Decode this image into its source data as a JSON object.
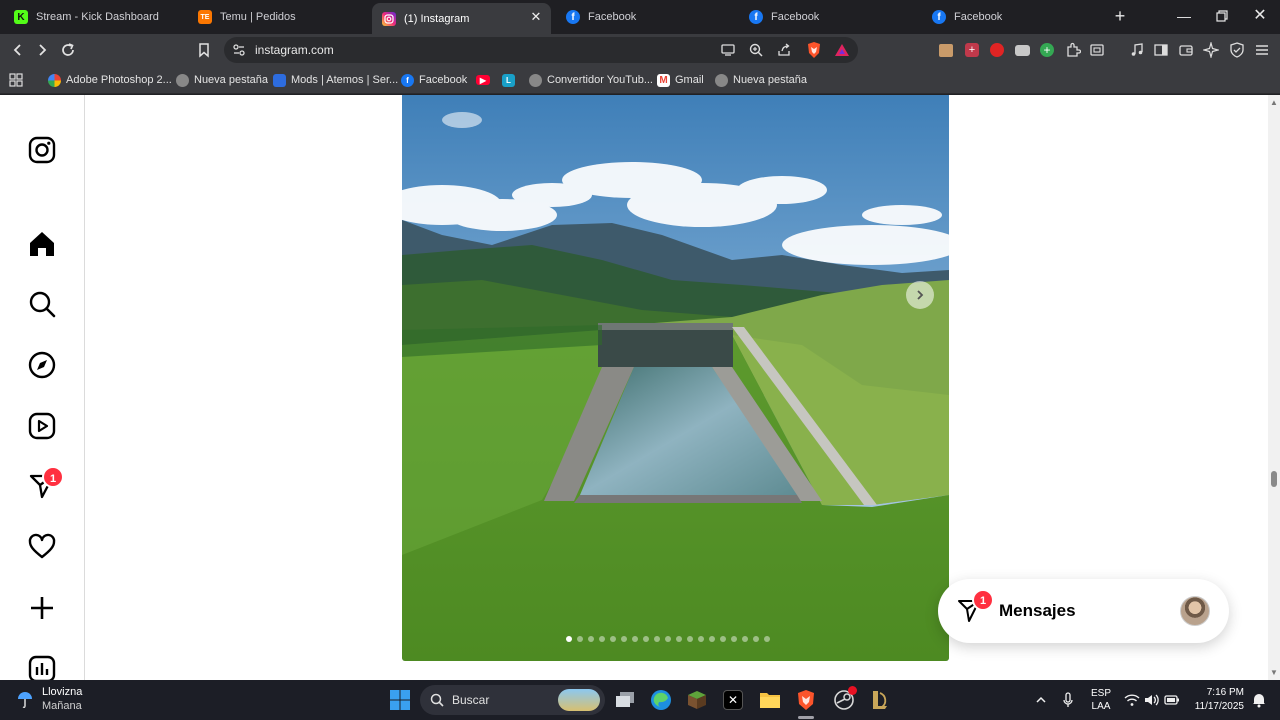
{
  "browser": {
    "tabs": [
      {
        "label": "Stream - Kick Dashboard",
        "icon": "kick-icon",
        "color": "#53fc18"
      },
      {
        "label": "Temu | Pedidos",
        "icon": "temu-icon",
        "color": "#fb7701"
      },
      {
        "label": "(1) Instagram",
        "icon": "instagram-icon",
        "active": true
      },
      {
        "label": "Facebook",
        "icon": "facebook-icon",
        "color": "#1877f2"
      },
      {
        "label": "Facebook",
        "icon": "facebook-icon",
        "color": "#1877f2"
      },
      {
        "label": "Facebook",
        "icon": "facebook-icon",
        "color": "#1877f2"
      }
    ],
    "url": "instagram.com",
    "bookmarks": [
      {
        "label": "Adobe Photoshop 2..."
      },
      {
        "label": "Nueva pestaña"
      },
      {
        "label": "Mods | Atemos | Ser..."
      },
      {
        "label": "Facebook"
      },
      {
        "label": "Convertidor YouTub..."
      },
      {
        "label": "Gmail"
      },
      {
        "label": "Nueva pestaña"
      }
    ],
    "bookmark_letter": "L"
  },
  "instagram": {
    "sidebar": {
      "notifications_badge": "1"
    },
    "post": {
      "carousel_total": 19,
      "carousel_current": 1
    },
    "messages": {
      "title": "Mensajes",
      "badge": "1"
    }
  },
  "taskbar": {
    "weather_condition": "Llovizna",
    "weather_when": "Mañana",
    "search_placeholder": "Buscar",
    "lang_line1": "ESP",
    "lang_line2": "LAA",
    "time": "7:16 PM",
    "date": "11/17/2025"
  },
  "colors": {
    "instagram_badge": "#ff3040",
    "browser_bg": "#3a3b3f",
    "taskbar_bg": "#1c1e26"
  }
}
